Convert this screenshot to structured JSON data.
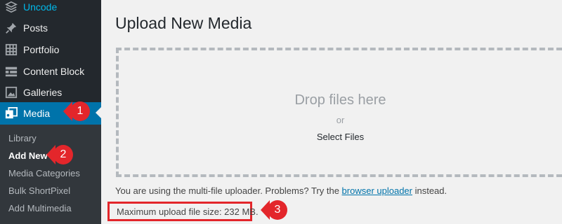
{
  "sidebar": {
    "items": [
      {
        "label": "Uncode",
        "icon": "layers-icon"
      },
      {
        "label": "Posts",
        "icon": "pin-icon"
      },
      {
        "label": "Portfolio",
        "icon": "grid-icon"
      },
      {
        "label": "Content Block",
        "icon": "blocks-icon"
      },
      {
        "label": "Galleries",
        "icon": "image-icon"
      },
      {
        "label": "Media",
        "icon": "media-icon"
      }
    ],
    "submenu": [
      {
        "label": "Library"
      },
      {
        "label": "Add New"
      },
      {
        "label": "Media Categories"
      },
      {
        "label": "Bulk ShortPixel"
      },
      {
        "label": "Add Multimedia"
      }
    ]
  },
  "main": {
    "title": "Upload New Media",
    "drop_text": "Drop files here",
    "or_text": "or",
    "select_files": "Select Files",
    "uploader_note_prefix": "You are using the multi-file uploader. Problems? Try the ",
    "uploader_link": "browser uploader",
    "uploader_note_suffix": " instead.",
    "max_upload": "Maximum upload file size: 232 MB."
  },
  "callouts": [
    "1",
    "2",
    "3"
  ],
  "colors": {
    "sidebar_bg": "#23282d",
    "submenu_bg": "#32373c",
    "active_bg": "#0073aa",
    "callout_red": "#e3262b"
  }
}
